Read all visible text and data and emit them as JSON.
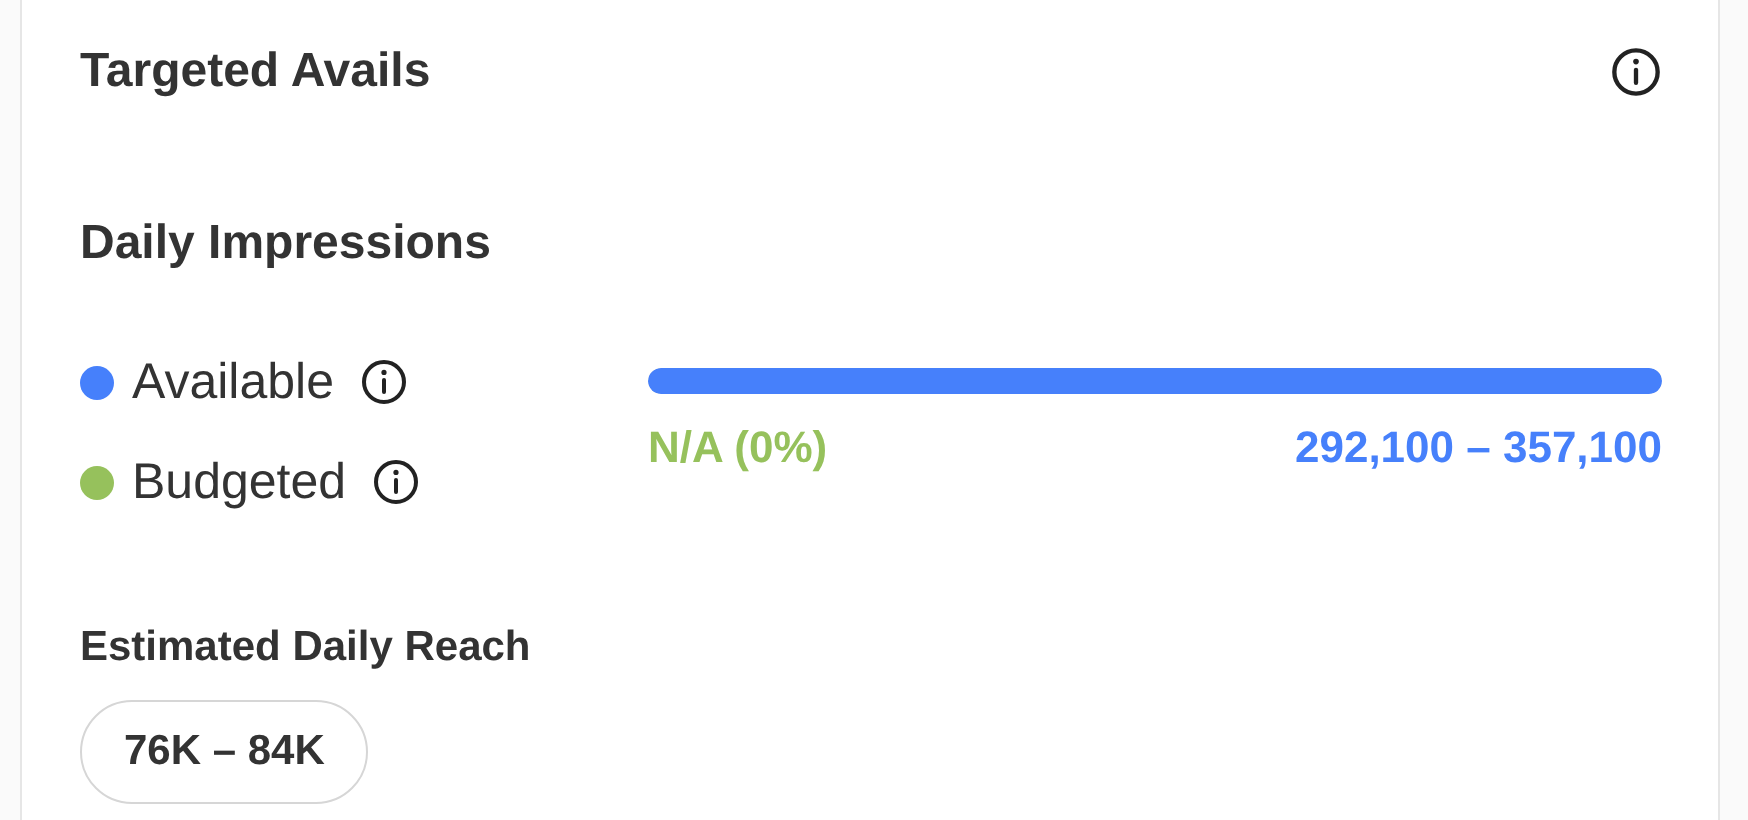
{
  "card": {
    "title": "Targeted Avails"
  },
  "impressions": {
    "heading": "Daily Impressions",
    "legend": [
      {
        "label": "Available",
        "color": "#4680fb"
      },
      {
        "label": "Budgeted",
        "color": "#96c15c"
      }
    ],
    "bar": {
      "level": 1
    },
    "budgeted_value": "N/A (0%)",
    "available_value": "292,100 – 357,100"
  },
  "reach": {
    "heading": "Estimated Daily Reach",
    "value": "76K – 84K"
  }
}
